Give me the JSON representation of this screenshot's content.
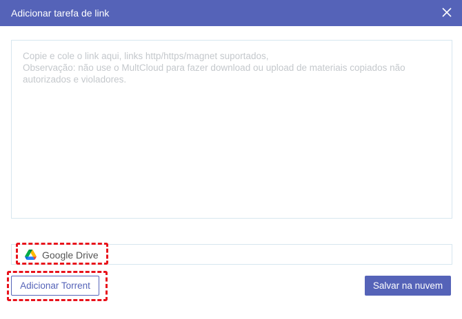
{
  "dialog": {
    "title": "Adicionar tarefa de link",
    "close_icon": "close-icon"
  },
  "link_input": {
    "value": "",
    "placeholder": "Copie e cole o link aqui, links http/https/magnet suportados,\nObservação: não use o MultCloud para fazer download ou upload de materiais copiados não autorizados e violadores."
  },
  "destination": {
    "icon": "google-drive-icon",
    "label": "Google Drive"
  },
  "buttons": {
    "add_torrent": "Adicionar Torrent",
    "save_to_cloud": "Salvar na nuvem"
  },
  "colors": {
    "accent": "#5563b8",
    "highlight": "#e8121b",
    "border": "#d6e6ef",
    "placeholder": "#c4c8cc"
  }
}
